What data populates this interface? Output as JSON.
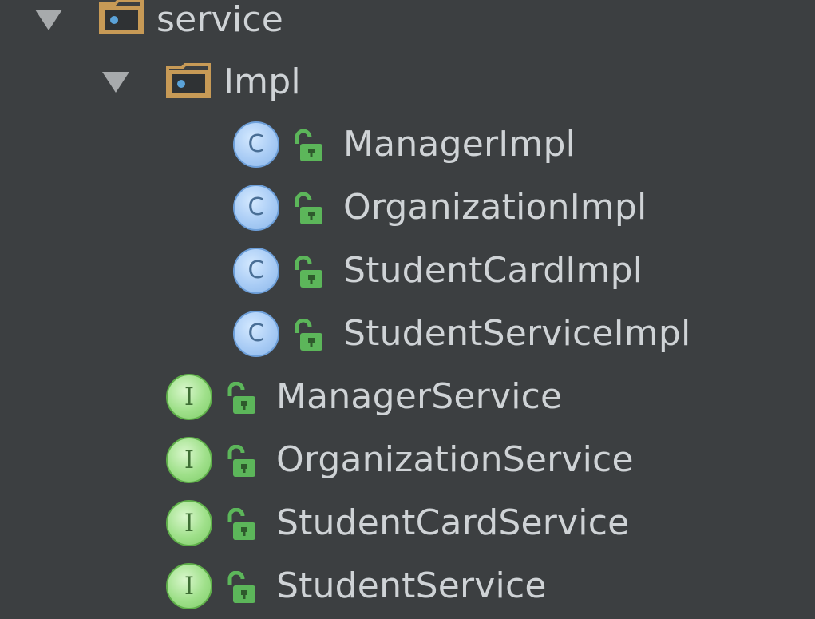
{
  "tree": {
    "service": {
      "label": "service",
      "icon": "package-folder-icon",
      "expanded": true
    },
    "impl": {
      "label": "Impl",
      "icon": "package-folder-icon",
      "expanded": true
    },
    "classes": [
      {
        "label": "ManagerImpl",
        "icon": "class-icon",
        "badge": "C",
        "visibility": "public-lock-icon"
      },
      {
        "label": "OrganizationImpl",
        "icon": "class-icon",
        "badge": "C",
        "visibility": "public-lock-icon"
      },
      {
        "label": "StudentCardImpl",
        "icon": "class-icon",
        "badge": "C",
        "visibility": "public-lock-icon"
      },
      {
        "label": "StudentServiceImpl",
        "icon": "class-icon",
        "badge": "C",
        "visibility": "public-lock-icon"
      }
    ],
    "interfaces": [
      {
        "label": "ManagerService",
        "icon": "interface-icon",
        "badge": "I",
        "visibility": "public-lock-icon"
      },
      {
        "label": "OrganizationService",
        "icon": "interface-icon",
        "badge": "I",
        "visibility": "public-lock-icon"
      },
      {
        "label": "StudentCardService",
        "icon": "interface-icon",
        "badge": "I",
        "visibility": "public-lock-icon"
      },
      {
        "label": "StudentService",
        "icon": "interface-icon",
        "badge": "I",
        "visibility": "public-lock-icon"
      }
    ]
  },
  "colors": {
    "background": "#3c3f41",
    "text": "#cfd3d6",
    "folder": "#c79a56",
    "folder_dot": "#5ba3d9",
    "lock": "#5cb65a",
    "class_icon": "#a9ccf5",
    "interface_icon": "#9fe08a"
  }
}
